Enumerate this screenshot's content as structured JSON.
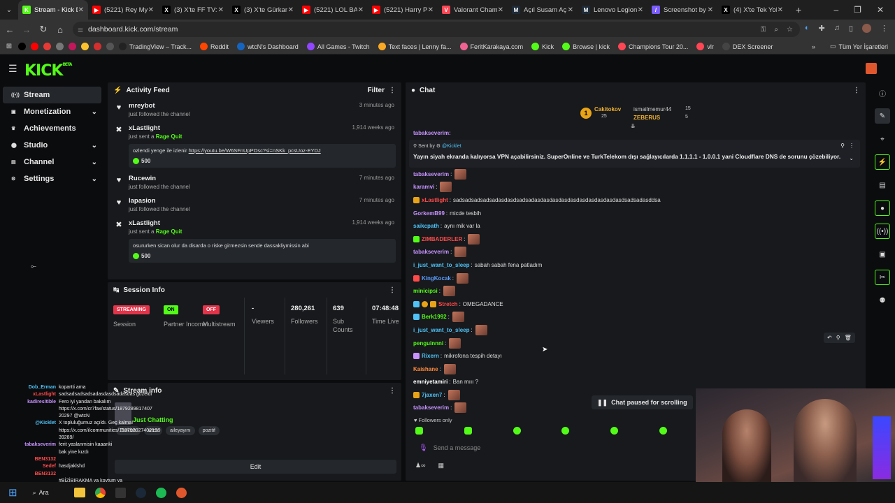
{
  "browser": {
    "tabs": [
      {
        "title": "Stream - Kick D",
        "color": "#53fc18",
        "glyph": "K",
        "active": true
      },
      {
        "title": "(5221) Rey My",
        "color": "#ff0000",
        "glyph": "▶",
        "active": false
      },
      {
        "title": "(3) X'te FF TV:",
        "color": "#000000",
        "glyph": "X",
        "active": false
      },
      {
        "title": "(3) X'te Gürkan",
        "color": "#000000",
        "glyph": "X",
        "active": false
      },
      {
        "title": "(5221) LOL BA(",
        "color": "#ff0000",
        "glyph": "▶",
        "active": false
      },
      {
        "title": "(5221) Harry P",
        "color": "#ff0000",
        "glyph": "▶",
        "active": false
      },
      {
        "title": "Valorant Cham",
        "color": "#ff4655",
        "glyph": "V",
        "active": false
      },
      {
        "title": "Açıl Susam Aç",
        "color": "#1e2a38",
        "glyph": "M",
        "active": false
      },
      {
        "title": "Lenovo Legion",
        "color": "#1e2a38",
        "glyph": "M",
        "active": false
      },
      {
        "title": "Screenshot by",
        "color": "#7b5cff",
        "glyph": "/",
        "active": false
      },
      {
        "title": "(4) X'te Tek Yol",
        "color": "#000000",
        "glyph": "X",
        "active": false
      }
    ],
    "url": "dashboard.kick.com/stream",
    "bookmarks": [
      {
        "label": "",
        "color": "#000000"
      },
      {
        "label": "",
        "color": "#ff0000"
      },
      {
        "label": "",
        "color": "#e53935"
      },
      {
        "label": "",
        "color": "#777777"
      },
      {
        "label": "",
        "color": "#c2185b"
      },
      {
        "label": "",
        "color": "#fbc02d"
      },
      {
        "label": "",
        "color": "#d32f2f"
      },
      {
        "label": "",
        "color": "#555555"
      },
      {
        "label": "TradingView – Track...",
        "color": "#222222"
      },
      {
        "label": "Reddit",
        "color": "#ff4500"
      },
      {
        "label": "wtcN's Dashboard",
        "color": "#1565c0"
      },
      {
        "label": "All Games - Twitch",
        "color": "#9146ff"
      },
      {
        "label": "Text faces | Lenny fa...",
        "color": "#f9a825"
      },
      {
        "label": "FeritKarakaya.com",
        "color": "#f06292"
      },
      {
        "label": "Kick",
        "color": "#53fc18"
      },
      {
        "label": "Browse | kick",
        "color": "#53fc18"
      },
      {
        "label": "Champions Tour 20...",
        "color": "#ff4655"
      },
      {
        "label": "vlr",
        "color": "#ff4655"
      },
      {
        "label": "DEX Screener",
        "color": "#444444"
      }
    ],
    "bookmarks_all": "Tüm Yer İşaretleri"
  },
  "kick": {
    "logo": "KICK",
    "logo_badge": "BETA",
    "sidebar": [
      {
        "label": "Stream",
        "icon": "broadcast-icon",
        "glyph": "((•))",
        "active": true,
        "chevron": false
      },
      {
        "label": "Monetization",
        "icon": "money-icon",
        "glyph": "▣",
        "active": false,
        "chevron": true
      },
      {
        "label": "Achievements",
        "icon": "trophy-icon",
        "glyph": "♛",
        "active": false,
        "chevron": false
      },
      {
        "label": "Studio",
        "icon": "studio-icon",
        "glyph": "⬤",
        "active": false,
        "chevron": true
      },
      {
        "label": "Channel",
        "icon": "channel-icon",
        "glyph": "▤",
        "active": false,
        "chevron": true
      },
      {
        "label": "Settings",
        "icon": "gear-icon",
        "glyph": "⚙",
        "active": false,
        "chevron": true
      }
    ],
    "activity": {
      "title": "Activity Feed",
      "filter": "Filter",
      "items": [
        {
          "name": "mreybot",
          "sub": "just followed the channel",
          "bold": "",
          "time": "3 minutes ago",
          "type": "follow",
          "message": "",
          "kicks": ""
        },
        {
          "name": "xLastlight",
          "sub": "just sent a ",
          "bold": "Rage Quit",
          "time": "1,914 weeks ago",
          "type": "kick",
          "message": "ozlendi yenge ile izlenir ",
          "link": "https://youtu.be/W6SFnUpPOsc?si=nSKk_pcsUoz-EYDJ",
          "kicks": "500"
        },
        {
          "name": "Rucewin",
          "sub": "just followed the channel",
          "bold": "",
          "time": "7 minutes ago",
          "type": "follow",
          "message": "",
          "kicks": ""
        },
        {
          "name": "lapasion",
          "sub": "just followed the channel",
          "bold": "",
          "time": "7 minutes ago",
          "type": "follow",
          "message": "",
          "kicks": ""
        },
        {
          "name": "xLastlight",
          "sub": "just sent a ",
          "bold": "Rage Quit",
          "time": "1,914 weeks ago",
          "type": "kick",
          "message": "osururken sican olur da disarda o riske girmezsin sende dassakliymissin abi",
          "link": "",
          "kicks": "500"
        }
      ]
    },
    "session": {
      "title": "Session Info",
      "streaming_badge": "STREAMING",
      "streaming_label": "Session",
      "on_badge": "ON",
      "partner_label": "Partner Income",
      "off_badge": "OFF",
      "multistream_label": "Multistream",
      "viewers_val": "-",
      "viewers_label": "Viewers",
      "followers_val": "280,261",
      "followers_label": "Followers",
      "subs_val": "639",
      "subs_label": "Sub Counts",
      "time_val": "07:48:48",
      "time_label": "Time Live"
    },
    "streaminfo": {
      "title": "Stream info",
      "category": "Just Chatting",
      "tags": [
        "Turkish",
        "wtcn",
        "aileyayını",
        "pozitif"
      ],
      "edit": "Edit"
    },
    "chat": {
      "title": "Chat",
      "leaderboard": [
        {
          "name": "Cakitokov",
          "value": "25",
          "rank": "1"
        },
        {
          "name": "ismailmemur44",
          "value": "15",
          "rank": ""
        },
        {
          "name": "ZEBERUS",
          "value": "5",
          "rank": ""
        }
      ],
      "pinned_sender_prefix": "Sent by",
      "pinned_sender": "@Kicklet",
      "pinned_text": "Yayın siyah ekranda kalıyorsa VPN açabilirsiniz. SuperOnline ve TurkTelekom dışı sağlayıcılarda 1.1.1.1 - 1.0.0.1 yani Cloudflare DNS de sorunu çözebiliyor.",
      "top_partial": "tabakseverim:",
      "lines": [
        {
          "user": "tabakseverim",
          "color": "#c792ff",
          "text": "",
          "emote": true
        },
        {
          "user": "karamvi",
          "color": "#c792ff",
          "text": "",
          "emote": true
        },
        {
          "user": "xLastlight",
          "color": "#ff4a4a",
          "text": "sadsadsadsadsadasdasdsadsadasdasdasdasdasdasdasdasdasdasdsadsadasddsa",
          "emote": false
        },
        {
          "user": "GorkemB99",
          "color": "#c792ff",
          "text": "micde tesbih",
          "emote": false
        },
        {
          "user": "saikcpath",
          "color": "#4fc3f7",
          "text": "aynı mik var la",
          "emote": false
        },
        {
          "user": "ZIMBADERLER",
          "color": "#ff4a4a",
          "text": "",
          "emote": true
        },
        {
          "user": "tabakseverim",
          "color": "#c792ff",
          "text": "",
          "emote": true
        },
        {
          "user": "i_just_want_to_sleep",
          "color": "#4fc3f7",
          "text": "sabah sabah fena patladım",
          "emote": false
        },
        {
          "user": "KingKocak",
          "color": "#5c9dff",
          "text": "",
          "emote": true
        },
        {
          "user": "minicipsi",
          "color": "#53fc18",
          "text": "",
          "emote": true
        },
        {
          "user": "Stretch",
          "color": "#ff4a4a",
          "text": "OMEGADANCE",
          "emote": false
        },
        {
          "user": "Berk1992",
          "color": "#53fc18",
          "text": "",
          "emote": true
        },
        {
          "user": "i_just_want_to_sleep",
          "color": "#4fc3f7",
          "text": "",
          "emote": true
        },
        {
          "user": "penguinnni",
          "color": "#53fc18",
          "text": "",
          "emote": true
        },
        {
          "user": "Rixern",
          "color": "#4fc3f7",
          "text": "mikrofona tespih detayı",
          "emote": false
        },
        {
          "user": "Kaishane",
          "color": "#ff8a3d",
          "text": "",
          "emote": true
        },
        {
          "user": "emniyetamiri",
          "color": "#ffffff",
          "text": "Ban mııı ?",
          "emote": false
        },
        {
          "user": "7jaxen7",
          "color": "#4fc3f7",
          "text": "",
          "emote": true
        },
        {
          "user": "tabakseverim",
          "color": "#c792ff",
          "text": "",
          "emote": true
        }
      ],
      "paused": "Chat paused for scrolling",
      "followers_only": "Followers only",
      "placeholder": "Send a message"
    },
    "overlay_chat": [
      {
        "n": "Dob_Erman",
        "c": "#4fc3f7",
        "t": "kopartti ama"
      },
      {
        "n": "xLastlight",
        "c": "#ff4a4a",
        "t": "sadsadsadsadsadasdasdsadasdas guzeldi"
      },
      {
        "n": "kadiresitible",
        "c": "#c792ff",
        "t": "Fero iyi yandan bakalım"
      },
      {
        "n": "",
        "c": "#ffffff",
        "t": "https://x.com/cr7fax/status/1879289817407"
      },
      {
        "n": "",
        "c": "#ffffff",
        "t": "20297 @wtcN"
      },
      {
        "n": "@Kicklet",
        "c": "#4fc3f7",
        "t": "X topluluğumuz açıldı. Geç kalma!"
      },
      {
        "n": "",
        "c": "#ffffff",
        "t": "https://x.com/i/communities/1937939274021S9"
      },
      {
        "n": "",
        "c": "#ffffff",
        "t": "39289/"
      },
      {
        "n": "tabakseverim",
        "c": "#c792ff",
        "t": "ferit yaslanmisin kaaanki"
      },
      {
        "n": "",
        "c": "#ffffff",
        "t": "bak yine kızdı"
      },
      {
        "n": "BEN3132",
        "c": "#ff4a4a",
        "t": ""
      },
      {
        "n": "Sedef",
        "c": "#ff4a4a",
        "t": "hasdjaklshd"
      },
      {
        "n": "BEN3132",
        "c": "#ff4a4a",
        "t": ""
      },
      {
        "n": "",
        "c": "#ffffff",
        "t": "#BİZİBIRAKMA ya kovtum ya"
      }
    ],
    "taskbar_search": "Ara"
  }
}
